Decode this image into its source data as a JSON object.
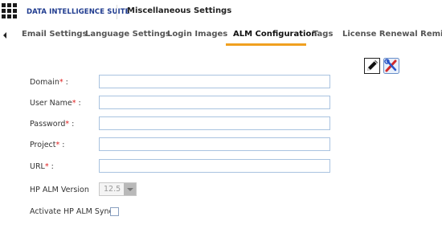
{
  "header": {
    "suite_title": "DATA INTELLIGENCE SUITE",
    "page_title": "Miscellaneous Settings"
  },
  "tabs": [
    {
      "label": "Email Settings",
      "active": false
    },
    {
      "label": "Language Settings",
      "active": false
    },
    {
      "label": "Login Images",
      "active": false
    },
    {
      "label": "ALM Configuration",
      "active": true
    },
    {
      "label": "Tags",
      "active": false
    },
    {
      "label": "License Renewal Reminder",
      "active": false
    }
  ],
  "toolbar": {
    "edit_icon": "edit-pencil-icon",
    "tools_icon": "tools-wrench-screwdriver-icon"
  },
  "form": {
    "domain": {
      "label": "Domain",
      "required_mark": "*",
      "colon": " :",
      "value": ""
    },
    "user_name": {
      "label": "User Name",
      "required_mark": "*",
      "colon": " :",
      "value": ""
    },
    "password": {
      "label": "Password",
      "required_mark": "*",
      "colon": " :",
      "value": ""
    },
    "project": {
      "label": "Project",
      "required_mark": "*",
      "colon": " :",
      "value": ""
    },
    "url": {
      "label": "URL",
      "required_mark": "*",
      "colon": " :",
      "value": ""
    },
    "hp_alm_version": {
      "label": "HP ALM Version",
      "value": "12.5"
    },
    "activate_sync": {
      "label": "Activate HP ALM Sync",
      "checked": false
    }
  },
  "colors": {
    "brand": "#1f3b8f",
    "active_tab_underline": "#f0a020",
    "required": "#e02020",
    "input_border": "#a9c3e0"
  }
}
